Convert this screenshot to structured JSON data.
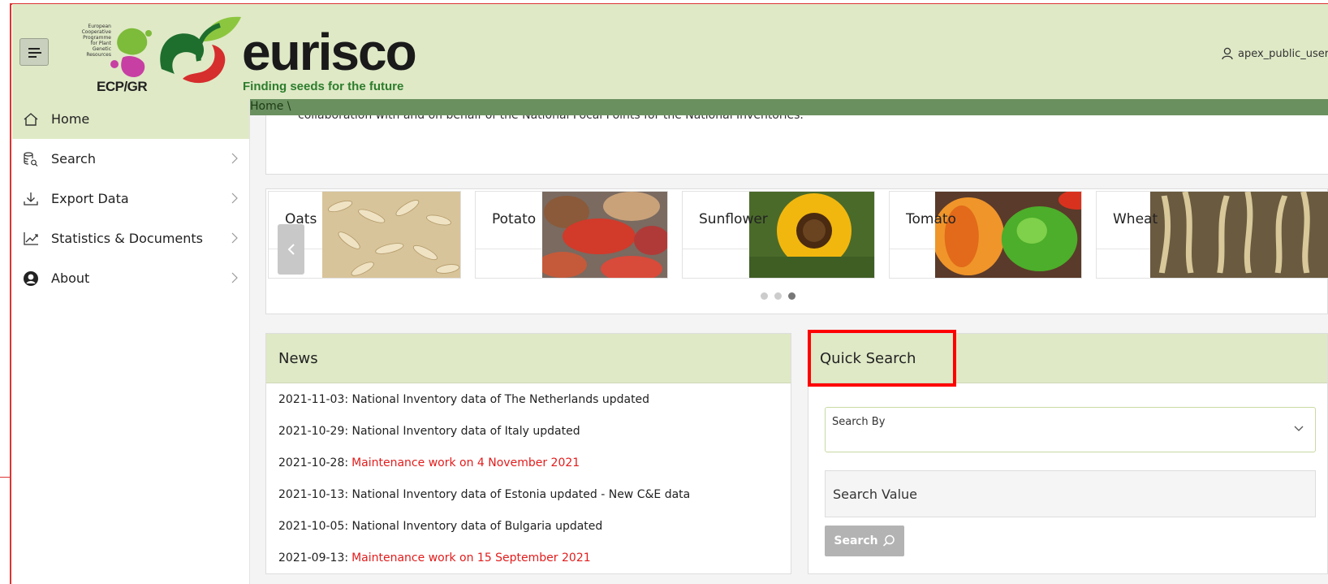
{
  "header": {
    "ecp_text_lines": [
      "European",
      "Cooperative",
      "Programme",
      "for Plant",
      "Genetic",
      "Resources"
    ],
    "ecp_mark": "ECP/GR",
    "brand": "eurisco",
    "tagline": "Finding seeds for the future",
    "user": "apex_public_user"
  },
  "sidebar": {
    "items": [
      {
        "label": "Home",
        "icon": "home-icon"
      },
      {
        "label": "Search",
        "icon": "database-search-icon"
      },
      {
        "label": "Export Data",
        "icon": "download-icon"
      },
      {
        "label": "Statistics & Documents",
        "icon": "chart-line-icon"
      },
      {
        "label": "About",
        "icon": "user-circle-icon"
      }
    ]
  },
  "breadcrumb": "Home \\",
  "intro_text": "collaboration with and on behalf of the National Focal Points for the National Inventories.",
  "carousel": {
    "crops": [
      "Oats",
      "Potato",
      "Sunflower",
      "Tomato",
      "Wheat"
    ],
    "dots": 3,
    "active_dot": 3
  },
  "news": {
    "title": "News",
    "items": [
      {
        "date": "2021-11-03:",
        "text": "National Inventory data of The Netherlands updated",
        "highlight": ""
      },
      {
        "date": "2021-10-29:",
        "text": "National Inventory data of Italy updated",
        "highlight": ""
      },
      {
        "date": "2021-10-28:",
        "text": "",
        "highlight": "Maintenance work on 4 November 2021"
      },
      {
        "date": "2021-10-13:",
        "text": "National Inventory data of Estonia updated - New C&E data",
        "highlight": ""
      },
      {
        "date": "2021-10-05:",
        "text": "National Inventory data of Bulgaria updated",
        "highlight": ""
      },
      {
        "date": "2021-09-13:",
        "text": "",
        "highlight": "Maintenance work on 15 September 2021"
      }
    ]
  },
  "quick_search": {
    "title": "Quick Search",
    "search_by_label": "Search By",
    "search_value_label": "Search Value",
    "button_label": "Search"
  },
  "colors": {
    "header_bg": "#dfe9c6",
    "breadcrumb_bar": "#6b9060",
    "alert_red": "#e21c1c",
    "highlight_box": "#ff0000"
  }
}
